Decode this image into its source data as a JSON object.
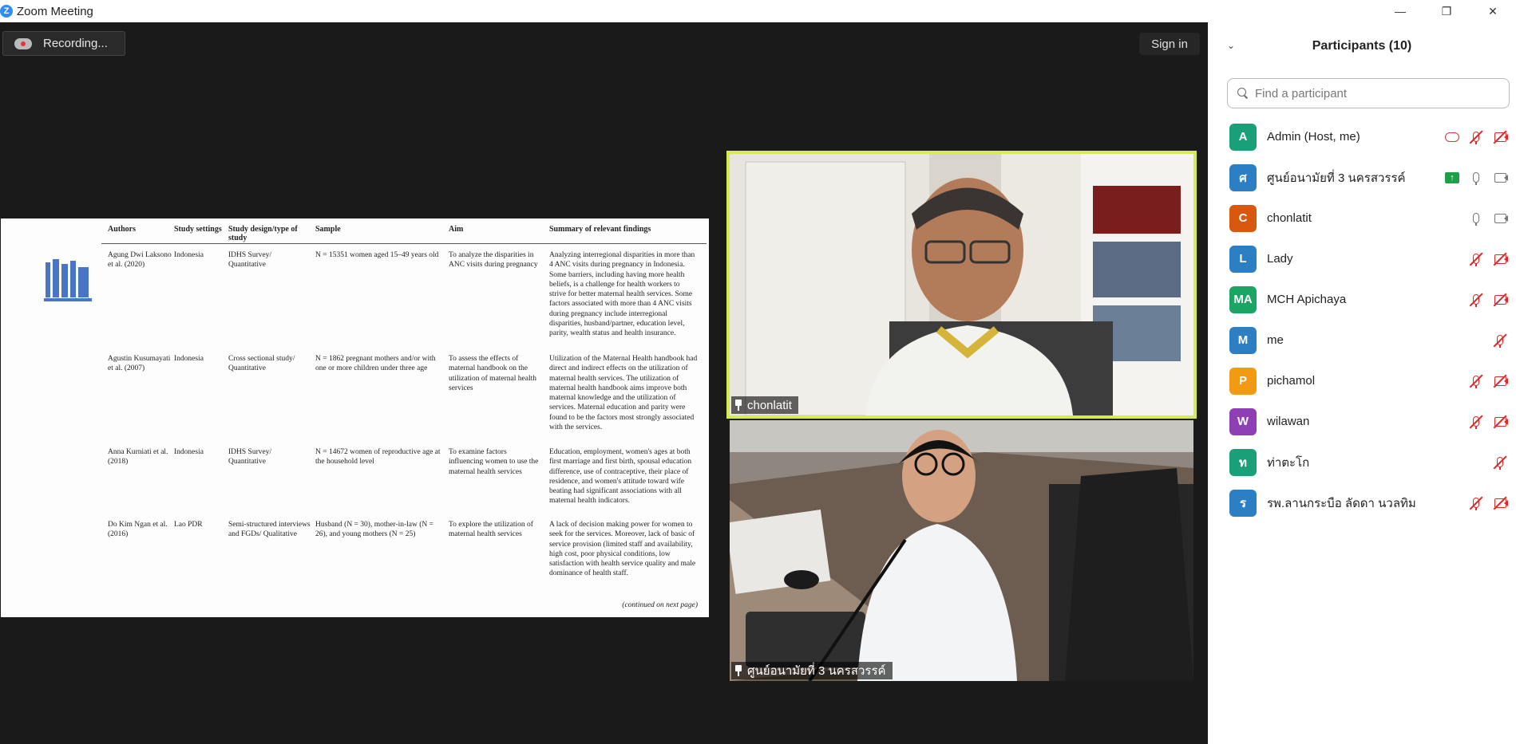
{
  "window": {
    "title": "Zoom Meeting",
    "logo_letter": "Z",
    "controls": [
      "—",
      "❐",
      "✕"
    ]
  },
  "toolbar": {
    "recording_label": "Recording...",
    "signin_label": "Sign in"
  },
  "shared_doc": {
    "headers": [
      "Authors",
      "Study settings",
      "Study design/type of study",
      "Sample",
      "Aim",
      "Summary of relevant findings"
    ],
    "rows": [
      [
        "Agung Dwi Laksono et al. (2020)",
        "Indonesia",
        "IDHS Survey/ Quantitative",
        "N = 15351 women aged 15–49 years old",
        "To analyze the disparities in ANC visits during pregnancy",
        "Analyzing interregional disparities in more than 4 ANC visits during pregnancy in Indonesia. Some barriers, including having more health beliefs, is a challenge for health workers to strive for better maternal health services. Some factors associated with more than 4 ANC visits during pregnancy include interregional disparities, husband/partner, education level, parity, wealth status and health insurance."
      ],
      [
        "Agustin Kusumayati et al. (2007)",
        "Indonesia",
        "Cross sectional study/ Quantitative",
        "N = 1862 pregnant mothers and/or with one or more children under three age",
        "To assess the effects of maternal handbook on the utilization of maternal health services",
        "Utilization of the Maternal Health handbook had direct and indirect effects on the utilization of maternal health services. The utilization of maternal health handbook aims improve both maternal knowledge and the utilization of services. Maternal education and parity were found to be the factors most strongly associated with the services."
      ],
      [
        "Anna Kurniati et al. (2018)",
        "Indonesia",
        "IDHS Survey/ Quantitative",
        "N = 14672 women of reproductive age at the household level",
        "To examine factors influencing women to use the maternal health services",
        "Education, employment, women's ages at both first marriage and first birth, spousal education difference, use of contraceptive, their place of residence, and women's attitude toward wife beating had significant associations with all maternal health indicators."
      ],
      [
        "Do Kim Ngan et al. (2016)",
        "Lao PDR",
        "Semi-structured interviews and FGDs/ Qualitative",
        "Husband (N = 30), mother-in-law (N = 26), and young mothers (N = 25)",
        "To explore the utilization of maternal health services",
        "A lack of decision making power for women to seek for the services. Moreover, lack of basic of service provision (limited staff and availability, high cost, poor physical conditions, low satisfaction with health service quality and male dominance of health staff."
      ]
    ],
    "footer": "(continued on next page)"
  },
  "videos": [
    {
      "name": "chonlatit"
    },
    {
      "name": "ศูนย์อนามัยที่ 3 นครสวรรค์"
    }
  ],
  "panel": {
    "title": "Participants (10)",
    "search_placeholder": "Find a participant",
    "participants": [
      {
        "initials": "A",
        "name": "Admin (Host, me)",
        "color": "#1aa079",
        "icons": [
          "rec",
          "mic-muted",
          "cam-off"
        ]
      },
      {
        "initials": "ศ",
        "name": "ศูนย์อนามัยที่ 3 นครสวรรค์",
        "color": "#2b7fc2",
        "icons": [
          "share",
          "mic",
          "cam"
        ]
      },
      {
        "initials": "C",
        "name": "chonlatit",
        "color": "#d9580f",
        "icons": [
          "mic",
          "cam"
        ]
      },
      {
        "initials": "L",
        "name": "Lady",
        "color": "#2b7fc2",
        "icons": [
          "mic-muted",
          "cam-off"
        ]
      },
      {
        "initials": "MA",
        "name": "MCH Apichaya",
        "color": "#1aa565",
        "icons": [
          "mic-muted",
          "cam-off"
        ]
      },
      {
        "initials": "M",
        "name": "me",
        "color": "#2b7fc2",
        "icons": [
          "mic-muted"
        ]
      },
      {
        "initials": "P",
        "name": "pichamol",
        "color": "#f29a12",
        "icons": [
          "mic-muted",
          "cam-off"
        ]
      },
      {
        "initials": "W",
        "name": "wilawan",
        "color": "#8e3fb3",
        "icons": [
          "mic-muted",
          "cam-off"
        ]
      },
      {
        "initials": "ท",
        "name": "ท่าตะโก",
        "color": "#1aa079",
        "icons": [
          "mic-muted"
        ]
      },
      {
        "initials": "ร",
        "name": "รพ.ลานกระบือ ลัดดา นวลทิม",
        "color": "#2b7fc2",
        "icons": [
          "mic-muted",
          "cam-off"
        ]
      }
    ]
  }
}
